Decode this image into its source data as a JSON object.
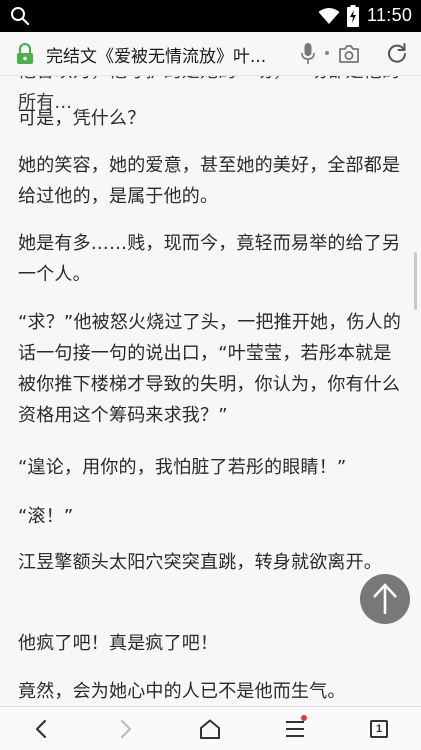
{
  "status_bar": {
    "time": "11:50",
    "icons": [
      "search-icon",
      "wifi-icon",
      "battery-charging-icon"
    ]
  },
  "address_bar": {
    "title": "完结文《爱被无情流放》叶...",
    "icons": [
      "lock-icon",
      "mic-icon",
      "camera-icon",
      "refresh-icon"
    ],
    "accent_color": "#4caf50"
  },
  "content": {
    "partial_top_line": "他曾以为，他守护的是她的一切，一切都是他的所有...",
    "paragraphs": [
      "可是，凭什么？",
      "她的笑容，她的爱意，甚至她的美好，全部都是给过他的，是属于他的。",
      "她是有多……贱，现而今，竟轻而易举的给了另一个人。",
      "“求？”他被怒火烧过了头，一把推开她，伤人的话一句接一句的说出口，“叶莹莹，若彤本就是被你推下楼梯才导致的失明，你认为，你有什么资格用这个筹码来求我？”",
      "“遑论，用你的，我怕脏了若彤的眼睛！”",
      "“滚！”",
      "江昱擎额头太阳穴突突直跳，转身就欲离开。",
      "他疯了吧！真是疯了吧！",
      "竟然，会为她心中的人已不是他而生气。"
    ]
  },
  "floating": {
    "back_to_top_icon": "arrow-up-icon"
  },
  "bottom_bar": {
    "icons": [
      "back-icon",
      "forward-icon",
      "home-icon",
      "menu-icon",
      "tabs-icon"
    ],
    "tab_count": "1",
    "menu_badge_color": "#e8373c"
  }
}
